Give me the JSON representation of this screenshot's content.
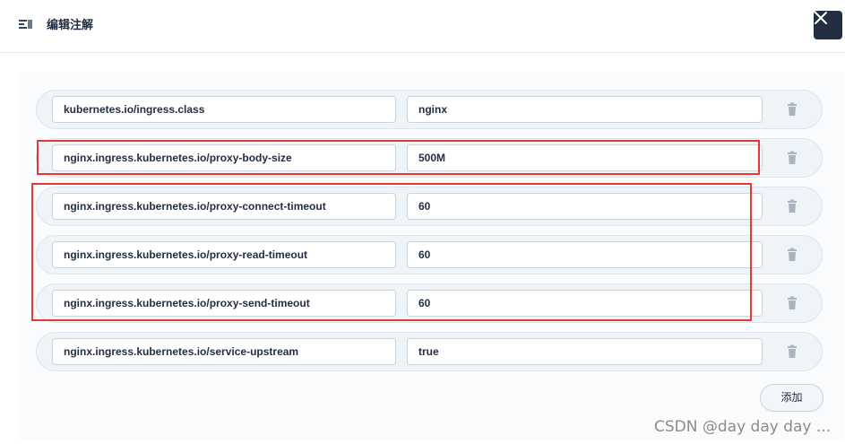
{
  "header": {
    "title": "编辑注解",
    "icon": "annotation-icon",
    "close_icon": "close-icon"
  },
  "annotations": [
    {
      "key": "kubernetes.io/ingress.class",
      "value": "nginx"
    },
    {
      "key": "nginx.ingress.kubernetes.io/proxy-body-size",
      "value": "500M"
    },
    {
      "key": "nginx.ingress.kubernetes.io/proxy-connect-timeout",
      "value": "60"
    },
    {
      "key": "nginx.ingress.kubernetes.io/proxy-read-timeout",
      "value": "60"
    },
    {
      "key": "nginx.ingress.kubernetes.io/proxy-send-timeout",
      "value": "60"
    },
    {
      "key": "nginx.ingress.kubernetes.io/service-upstream",
      "value": "true"
    }
  ],
  "delete_icon": "trash-icon",
  "add_label": "添加",
  "watermark": "CSDN @day day day ...",
  "colors": {
    "dark": "#242e42",
    "row_bg": "#eff4f9",
    "highlight": "#e53935"
  }
}
